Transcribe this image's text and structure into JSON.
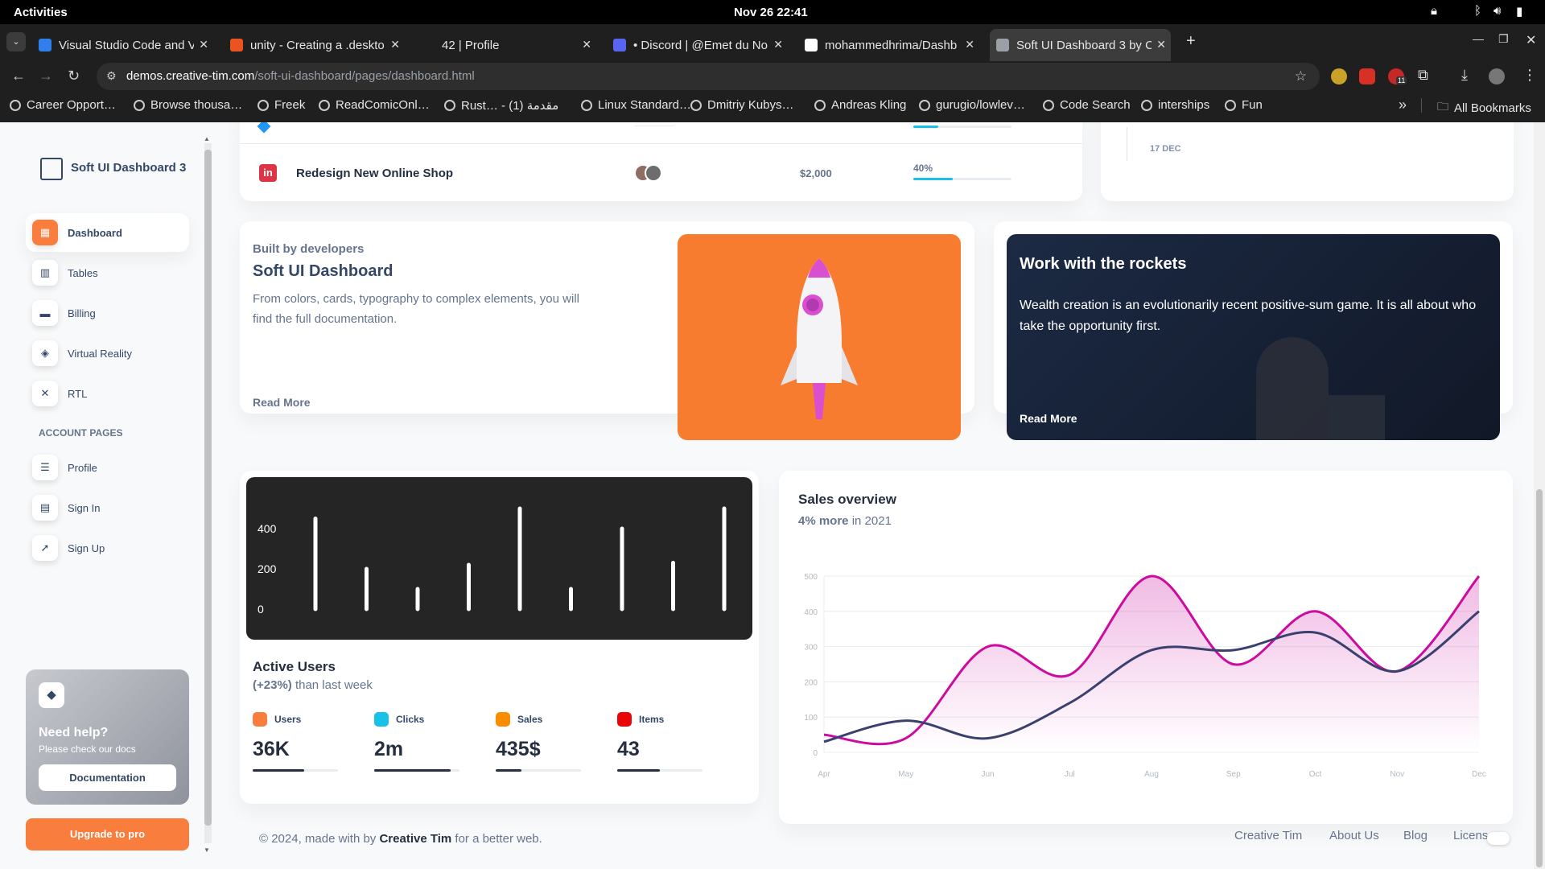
{
  "system_bar": {
    "activities": "Activities",
    "clock": "Nov 26  22:41"
  },
  "browser": {
    "tabs": [
      {
        "title": "Visual Studio Code and V",
        "color": "#2f80ed"
      },
      {
        "title": "unity - Creating a .deskto",
        "color": "#e95420"
      },
      {
        "title": "42 | Profile",
        "color": "#1f1f1f"
      },
      {
        "title": "• Discord | @Emet du No",
        "color": "#5865f2"
      },
      {
        "title": "mohammedhrima/Dashb",
        "color": "#ffffff"
      },
      {
        "title": "Soft UI Dashboard 3 by C",
        "color": "#9aa0a6"
      }
    ],
    "new_tab": "+",
    "address_host": "demos.creative-tim.com",
    "address_path": "/soft-ui-dashboard/pages/dashboard.html",
    "extension_badge": "11",
    "bookmarks": [
      "Career Opport…",
      "Browse thousa…",
      "Freek",
      "ReadComicOnl…",
      "Rust… - مقدمة (1)",
      "Linux Standard…",
      "Dmitriy Kubys…",
      "Andreas Kling",
      "gurugio/lowlev…",
      "Code Search",
      "interships",
      "Fun"
    ],
    "bookmarks_more": "»",
    "all_bookmarks": "All Bookmarks"
  },
  "sidebar": {
    "brand": "Soft UI Dashboard 3",
    "items": [
      {
        "label": "Dashboard",
        "icon": "shop-icon",
        "glyph": "▦"
      },
      {
        "label": "Tables",
        "icon": "office-icon",
        "glyph": "▥"
      },
      {
        "label": "Billing",
        "icon": "credit-card-icon",
        "glyph": "▬"
      },
      {
        "label": "Virtual Reality",
        "icon": "box-3d-icon",
        "glyph": "◈"
      },
      {
        "label": "RTL",
        "icon": "settings-icon",
        "glyph": "✕"
      }
    ],
    "section_label": "ACCOUNT PAGES",
    "account_items": [
      {
        "label": "Profile",
        "icon": "customer-support-icon",
        "glyph": "☰"
      },
      {
        "label": "Sign In",
        "icon": "document-icon",
        "glyph": "▤"
      },
      {
        "label": "Sign Up",
        "icon": "spaceship-icon",
        "glyph": "➚"
      }
    ],
    "help": {
      "title": "Need help?",
      "subtitle": "Please check our docs",
      "button": "Documentation"
    },
    "upgrade_button": "Upgrade to pro"
  },
  "projects_row": {
    "name": "Redesign New Online Shop",
    "budget": "$2,000",
    "completion": "40%",
    "completion_value": 40
  },
  "timeline": {
    "date": "17 DEC"
  },
  "built_card": {
    "eyebrow": "Built by developers",
    "title": "Soft UI Dashboard",
    "text": "From colors, cards, typography to complex elements, you will find the full documentation.",
    "link": "Read More"
  },
  "rockets_card": {
    "title": "Work with the rockets",
    "text": "Wealth creation is an evolutionarily recent positive-sum game. It is all about who take the opportunity first.",
    "link": "Read More"
  },
  "active_users": {
    "title": "Active Users",
    "change": "(+23%)",
    "change_suffix": " than last week",
    "stats": [
      {
        "label": "Users",
        "value": "36K",
        "progress": 60,
        "color": "#f97d3c",
        "icon": "library-icon"
      },
      {
        "label": "Clicks",
        "value": "2m",
        "progress": 90,
        "color": "#17c1e8",
        "icon": "click-icon"
      },
      {
        "label": "Sales",
        "value": "435$",
        "progress": 30,
        "color": "#fb8c00",
        "icon": "cart-icon"
      },
      {
        "label": "Items",
        "value": "43",
        "progress": 50,
        "color": "#ea0606",
        "icon": "settings-icon"
      }
    ]
  },
  "sales_overview": {
    "title": "Sales overview",
    "highlight": "4% more",
    "suffix": " in 2021"
  },
  "chart_data": [
    {
      "type": "bar",
      "categories": [
        "",
        "",
        "",
        "",
        "",
        "",
        "",
        "",
        ""
      ],
      "values": [
        450,
        200,
        100,
        220,
        500,
        100,
        400,
        230,
        500
      ],
      "ylim": [
        0,
        500
      ],
      "yticks": [
        "400",
        "200",
        "0"
      ]
    },
    {
      "type": "area",
      "categories": [
        "Apr",
        "May",
        "Jun",
        "Jul",
        "Aug",
        "Sep",
        "Oct",
        "Nov",
        "Dec"
      ],
      "yticks": [
        "500",
        "400",
        "300",
        "200",
        "100",
        "0"
      ],
      "ylim": [
        0,
        500
      ],
      "series": [
        {
          "values": [
            50,
            40,
            300,
            220,
            500,
            250,
            400,
            230,
            500
          ],
          "color": "#cb0c9f"
        },
        {
          "values": [
            30,
            90,
            40,
            140,
            290,
            290,
            340,
            230,
            400
          ],
          "color": "#3a416f"
        }
      ]
    }
  ],
  "footer": {
    "prefix": "© 2024, made with by ",
    "author": "Creative Tim",
    "suffix": " for a better web.",
    "links": [
      "Creative Tim",
      "About Us",
      "Blog",
      "Licens"
    ]
  }
}
